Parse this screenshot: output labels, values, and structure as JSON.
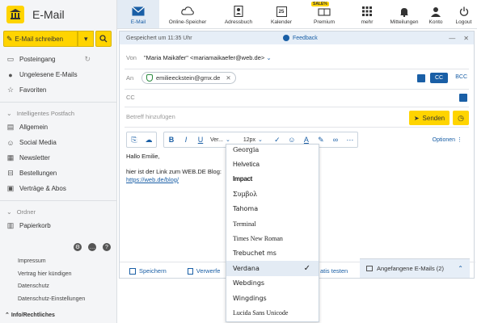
{
  "app": {
    "title": "E-Mail"
  },
  "sidebar": {
    "compose_label": "E-Mail schreiben",
    "items": [
      {
        "label": "Posteingang",
        "icon": "inbox-icon"
      },
      {
        "label": "Ungelesene E-Mails",
        "icon": "unread-dot-icon"
      },
      {
        "label": "Favoriten",
        "icon": "star-icon"
      }
    ],
    "section_smart": "Intelligentes Postfach",
    "smart_items": [
      {
        "label": "Allgemein",
        "icon": "general-icon"
      },
      {
        "label": "Social Media",
        "icon": "social-icon"
      },
      {
        "label": "Newsletter",
        "icon": "newsletter-icon"
      },
      {
        "label": "Bestellungen",
        "icon": "cart-icon"
      },
      {
        "label": "Verträge & Abos",
        "icon": "contract-icon"
      }
    ],
    "section_folder": "Ordner",
    "folder_items": [
      {
        "label": "Papierkorb",
        "icon": "trash-icon"
      }
    ],
    "footer_links": [
      "Impressum",
      "Vertrag hier kündigen",
      "Datenschutz",
      "Datenschutz-Einstellungen"
    ],
    "footer_bottom": "Info/Rechtliches"
  },
  "topnav": {
    "items": [
      {
        "label": "E-Mail",
        "icon": "mail-icon"
      },
      {
        "label": "Online-Speicher",
        "icon": "cloud-icon"
      },
      {
        "label": "Adressbuch",
        "icon": "addressbook-icon"
      },
      {
        "label": "Kalender",
        "icon": "calendar-icon"
      },
      {
        "label": "Premium",
        "icon": "premium-icon"
      },
      {
        "label": "mehr",
        "icon": "grid-icon"
      },
      {
        "label": "Mitteilungen",
        "icon": "bell-icon"
      },
      {
        "label": "Konto",
        "icon": "user-icon"
      },
      {
        "label": "Logout",
        "icon": "power-icon"
      }
    ],
    "calendar_day": "25",
    "sale_badge": "SALE%"
  },
  "compose": {
    "saved_status": "Gespeichert um 11:35 Uhr",
    "feedback": "Feedback",
    "from_label": "Von",
    "from_value": "\"Maria Maikäfer\" <mariamaikaefer@web.de>",
    "to_label": "An",
    "to_chip": "emilieeckstein@gmx.de",
    "cc_label": "CC",
    "cc_button": "CC",
    "bcc_button": "BCC",
    "subject_placeholder": "Betreff hinzufügen",
    "send_label": "Senden",
    "font_selector": "Ver...",
    "size_selector": "12px",
    "options_label": "Optionen",
    "body_lines": [
      "Hallo Emilie,",
      "",
      "hier ist der Link zum WEB.DE Blog:"
    ],
    "body_link": "https://web.de/blog/",
    "save_label": "Speichern",
    "discard_label": "Verwerfe",
    "test_label": "atis testen",
    "drafts_label": "Angefangene E-Mails (2)"
  },
  "font_dropdown": {
    "options": [
      "Georgia",
      "Helvetica",
      "Impact",
      "Συμβολ",
      "Tahoma",
      "Terminal",
      "Times New Roman",
      "Trebuchet ms",
      "Verdana",
      "Webdings",
      "Wingdings",
      "Lucida Sans Unicode"
    ],
    "selected": "Verdana"
  },
  "colors": {
    "accent_yellow": "#ffd400",
    "accent_blue": "#1a5fa6"
  }
}
